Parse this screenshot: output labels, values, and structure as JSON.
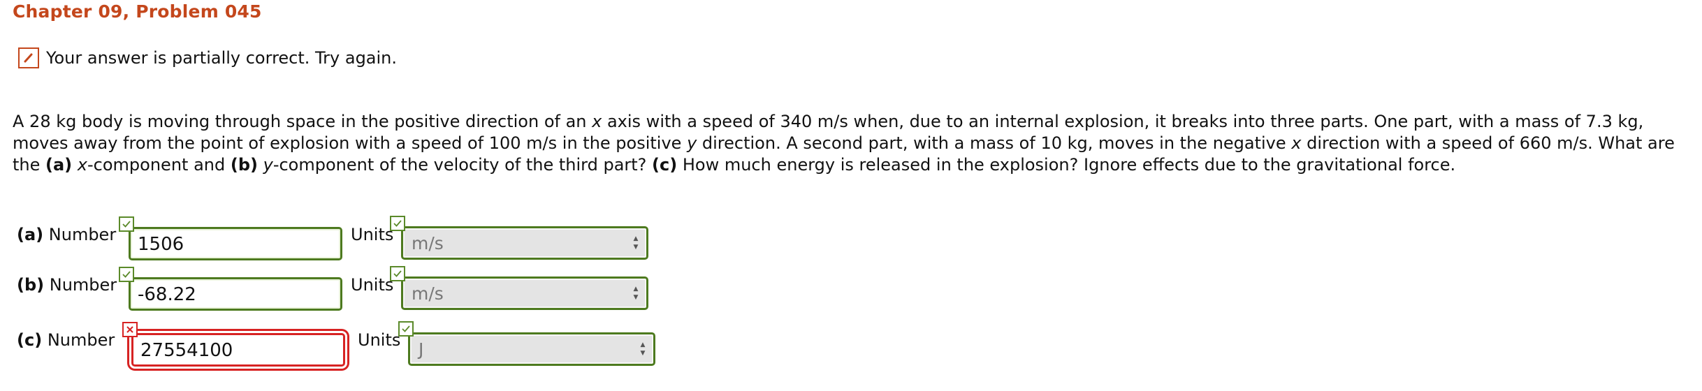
{
  "header": {
    "title": "Chapter 09, Problem 045"
  },
  "status": {
    "message": "Your answer is partially correct.  Try again.",
    "icon": "pencil-icon",
    "color": "#c4471c"
  },
  "problem": {
    "segments": [
      {
        "text": "A 28 kg body is moving through space in the positive direction of an ",
        "style": "normal"
      },
      {
        "text": "x",
        "style": "italic"
      },
      {
        "text": " axis with a speed of 340 m/s when, due to an internal explosion, it breaks into three parts. One part, with a mass of 7.3 kg, moves away from the point of explosion with a speed of 100 m/s in the positive ",
        "style": "normal"
      },
      {
        "text": "y",
        "style": "italic"
      },
      {
        "text": " direction. A second part, with a mass of 10 kg, moves in the negative ",
        "style": "normal"
      },
      {
        "text": "x",
        "style": "italic"
      },
      {
        "text": " direction with a speed of 660 m/s. What are the ",
        "style": "normal"
      },
      {
        "text": "(a)",
        "style": "bold"
      },
      {
        "text": " ",
        "style": "normal"
      },
      {
        "text": "x",
        "style": "italic"
      },
      {
        "text": "-component and ",
        "style": "normal"
      },
      {
        "text": "(b)",
        "style": "bold"
      },
      {
        "text": " ",
        "style": "normal"
      },
      {
        "text": "y",
        "style": "italic"
      },
      {
        "text": "-component of the velocity of the third part? ",
        "style": "normal"
      },
      {
        "text": "(c)",
        "style": "bold"
      },
      {
        "text": " How much energy is released in the explosion? Ignore effects due to the gravitational force.",
        "style": "normal"
      }
    ]
  },
  "answers": [
    {
      "part": "(a)",
      "number_label": "Number",
      "value": "1506",
      "number_status": "correct",
      "units_label": "Units",
      "unit": "m/s",
      "unit_status": "correct"
    },
    {
      "part": "(b)",
      "number_label": "Number",
      "value": "-68.22",
      "number_status": "correct",
      "units_label": "Units",
      "unit": "m/s",
      "unit_status": "correct"
    },
    {
      "part": "(c)",
      "number_label": "Number",
      "value": "27554100",
      "number_status": "incorrect",
      "units_label": "Units",
      "unit": "J",
      "unit_status": "correct"
    }
  ],
  "colors": {
    "title": "#c4471c",
    "correct": "#4d7a1f",
    "incorrect": "#d72323"
  },
  "icons": {
    "correct": "checkmark-icon",
    "incorrect": "x-mark-icon"
  }
}
